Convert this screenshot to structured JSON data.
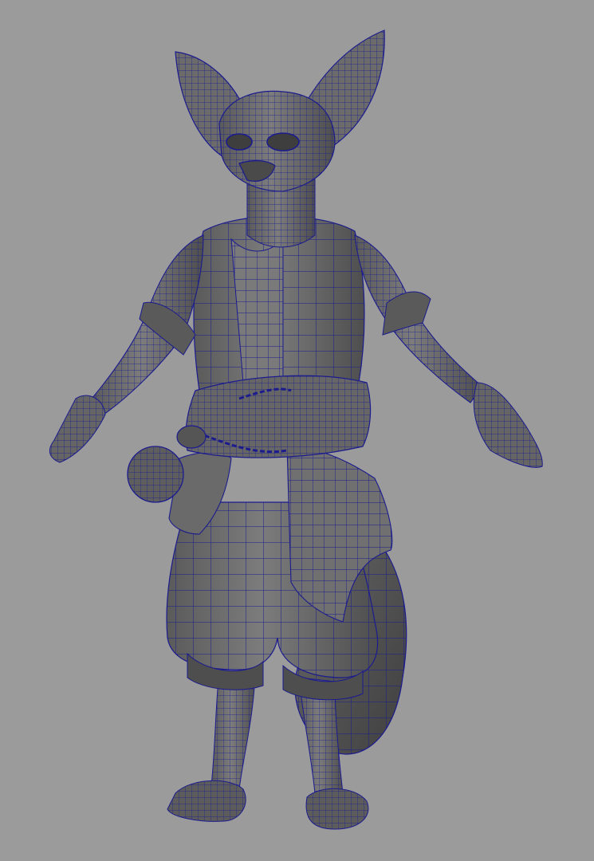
{
  "scene": {
    "background_color": "#9b9b9b",
    "mesh_fill_color": "#6f6f6f",
    "mesh_shadow_color": "#4a4a4a",
    "mesh_highlight_color": "#8c8c8c",
    "wireframe_color": "#1a1a8c"
  }
}
